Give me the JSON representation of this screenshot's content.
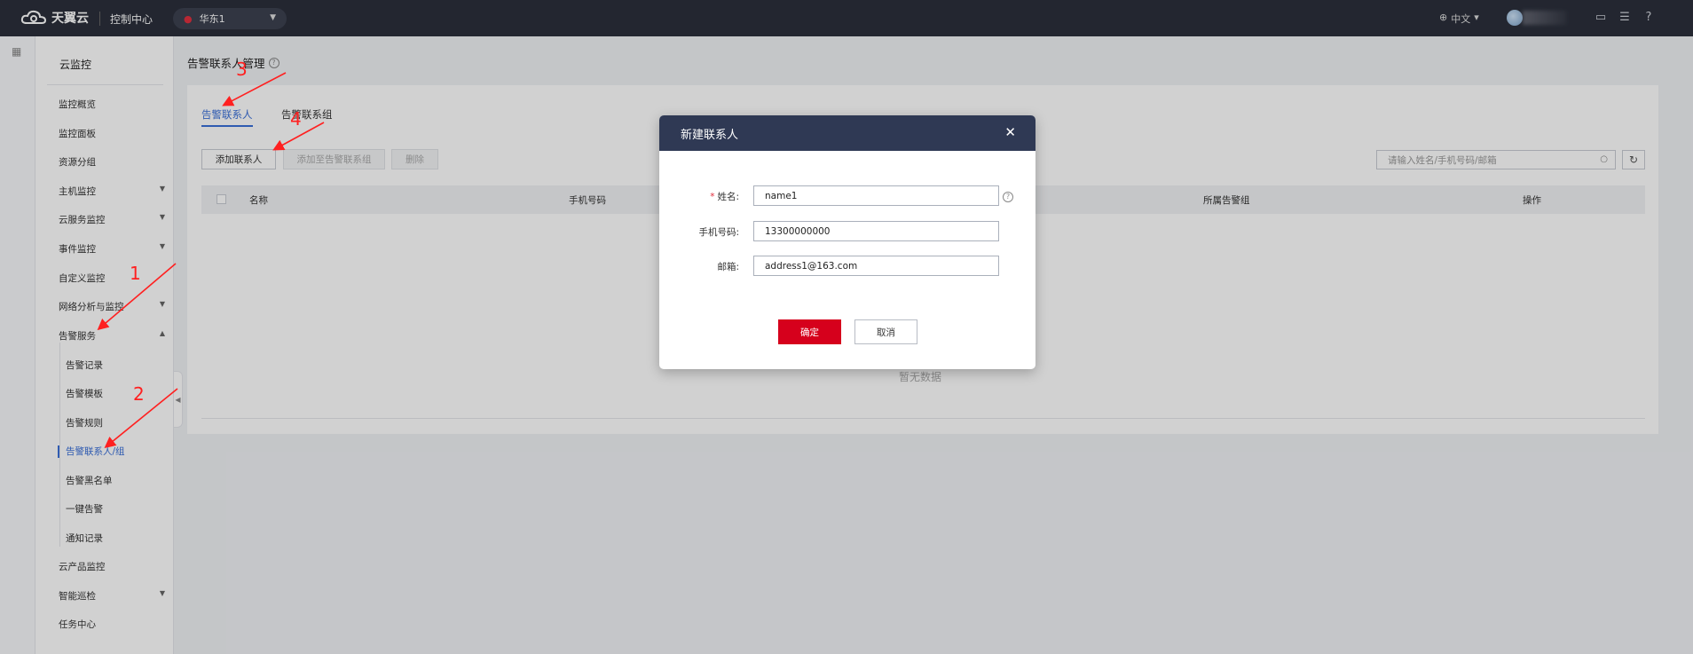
{
  "topbar": {
    "brand": "天翼云",
    "console": "控制中心",
    "region": "华东1",
    "language": "中文"
  },
  "sidebar": {
    "title": "云监控",
    "items": [
      {
        "label": "监控概览",
        "expandable": false
      },
      {
        "label": "监控面板",
        "expandable": false
      },
      {
        "label": "资源分组",
        "expandable": false
      },
      {
        "label": "主机监控",
        "expandable": true
      },
      {
        "label": "云服务监控",
        "expandable": true
      },
      {
        "label": "事件监控",
        "expandable": true
      },
      {
        "label": "自定义监控",
        "expandable": false
      },
      {
        "label": "网络分析与监控",
        "expandable": true
      },
      {
        "label": "告警服务",
        "expandable": true,
        "expanded": true
      }
    ],
    "alarm_sub": [
      {
        "label": "告警记录"
      },
      {
        "label": "告警模板"
      },
      {
        "label": "告警规则"
      },
      {
        "label": "告警联系人/组",
        "active": true
      },
      {
        "label": "告警黑名单"
      },
      {
        "label": "一键告警"
      },
      {
        "label": "通知记录"
      }
    ],
    "bottom_items": [
      {
        "label": "云产品监控",
        "expandable": false
      },
      {
        "label": "智能巡检",
        "expandable": true
      },
      {
        "label": "任务中心",
        "expandable": false
      }
    ]
  },
  "main": {
    "page_title": "告警联系人管理",
    "tabs": [
      {
        "label": "告警联系人",
        "active": true
      },
      {
        "label": "告警联系组",
        "active": false
      }
    ],
    "toolbar": {
      "add_contact": "添加联系人",
      "add_to_group": "添加至告警联系组",
      "delete": "删除"
    },
    "search": {
      "placeholder": "请输入姓名/手机号码/邮箱"
    },
    "table": {
      "columns": [
        "名称",
        "手机号码",
        "所属告警组",
        "操作"
      ],
      "empty_text": "暂无数据"
    }
  },
  "modal": {
    "title": "新建联系人",
    "fields": {
      "name": {
        "label": "姓名:",
        "value": "name1",
        "required": true
      },
      "phone": {
        "label": "手机号码:",
        "value": "13300000000"
      },
      "email": {
        "label": "邮箱:",
        "value": "address1@163.com"
      }
    },
    "ok": "确定",
    "cancel": "取消"
  },
  "annotations": [
    "1",
    "2",
    "3",
    "4"
  ],
  "colors": {
    "topbar_bg": "#2b2f3b",
    "modal_header_bg": "#2f3954",
    "primary_red": "#d6001c",
    "link_blue": "#3a6fd8",
    "annotation_red": "#ff2020"
  }
}
